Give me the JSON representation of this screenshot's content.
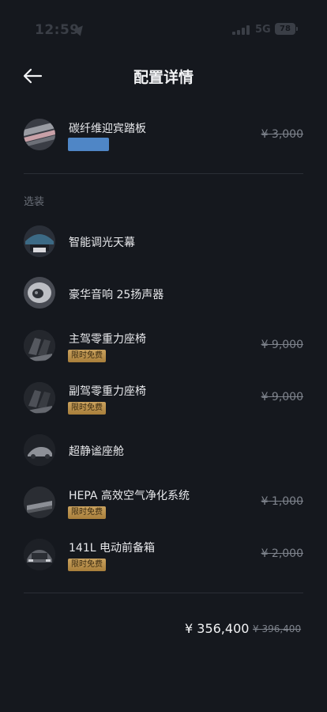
{
  "status_bar": {
    "time": "12:59",
    "network": "5G",
    "battery": "78"
  },
  "header": {
    "title": "配置详情"
  },
  "top_item": {
    "name": "碳纤维迎宾踏板",
    "price": "¥ 3,000"
  },
  "section": {
    "label": "选装"
  },
  "options": [
    {
      "name": "智能调光天幕"
    },
    {
      "name": "豪华音响 25扬声器"
    },
    {
      "name": "主驾零重力座椅",
      "badge": "限时免费",
      "price": "¥ 9,000"
    },
    {
      "name": "副驾零重力座椅",
      "badge": "限时免费",
      "price": "¥ 9,000"
    },
    {
      "name": "超静谧座舱"
    },
    {
      "name": "HEPA 高效空气净化系统",
      "badge": "限时免费",
      "price": "¥ 1,000"
    },
    {
      "name": "141L 电动前备箱",
      "badge": "限时免费",
      "price": "¥ 2,000"
    }
  ],
  "total": {
    "current": "¥ 356,400",
    "original": "¥ 396,400"
  }
}
